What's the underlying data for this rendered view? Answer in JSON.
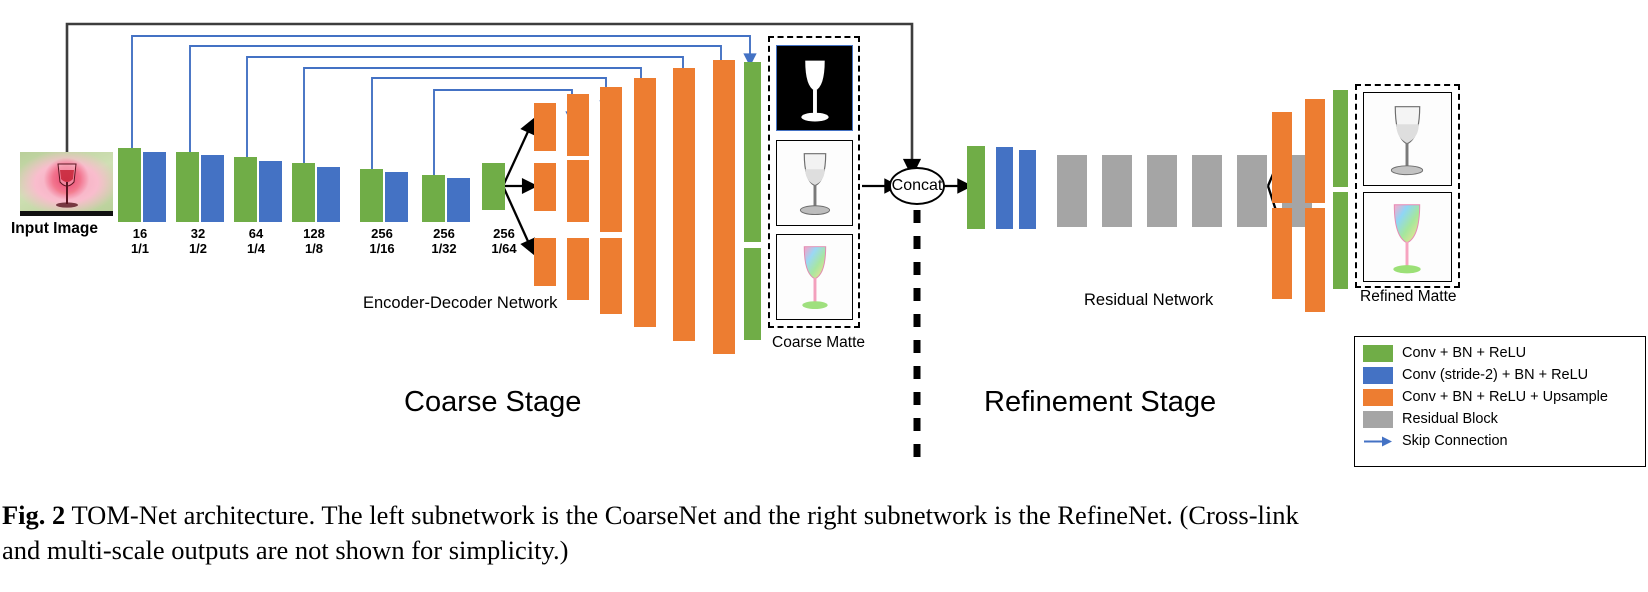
{
  "figure": {
    "caption_prefix": "Fig. 2",
    "caption_line1": "TOM-Net architecture. The left subnetwork is the CoarseNet and the right subnetwork is the RefineNet. (Cross-link",
    "caption_line2": "and multi-scale outputs are not shown for simplicity.)"
  },
  "colors": {
    "conv": "#70AD47",
    "conv_stride2": "#4472C4",
    "conv_upsample": "#ED7D31",
    "residual": "#A5A5A5",
    "skip": "#4472C4",
    "arrow": "#000000"
  },
  "labels": {
    "input_image": "Input Image",
    "encoder_decoder": "Encoder-Decoder Network",
    "coarse_matte": "Coarse Matte",
    "coarse_stage": "Coarse Stage",
    "concat": "Concat",
    "residual_network": "Residual Network",
    "refined_matte": "Refined Matte",
    "refinement_stage": "Refinement Stage"
  },
  "encoder": {
    "stages": [
      {
        "channels": "16",
        "scale": "1/1"
      },
      {
        "channels": "32",
        "scale": "1/2"
      },
      {
        "channels": "64",
        "scale": "1/4"
      },
      {
        "channels": "128",
        "scale": "1/8"
      },
      {
        "channels": "256",
        "scale": "1/16"
      },
      {
        "channels": "256",
        "scale": "1/32"
      },
      {
        "channels": "256",
        "scale": "1/64"
      }
    ]
  },
  "decoder": {
    "branches": 3,
    "blocks_per_branch": 6,
    "output_conv_segments": 3
  },
  "refinement": {
    "residual_blocks": 6,
    "head_conv": 1,
    "head_stride2_convs": 2,
    "tail_upsample_blocks_per_branch": 2,
    "tail_branches": 2
  },
  "legend": {
    "items": [
      {
        "icon": "green-square-icon",
        "swatch": "#70AD47",
        "label": "Conv + BN + ReLU"
      },
      {
        "icon": "blue-square-icon",
        "swatch": "#4472C4",
        "label": "Conv (stride-2) + BN + ReLU"
      },
      {
        "icon": "orange-square-icon",
        "swatch": "#ED7D31",
        "label": "Conv + BN + ReLU + Upsample"
      },
      {
        "icon": "gray-square-icon",
        "swatch": "#A5A5A5",
        "label": "Residual Block"
      },
      {
        "icon": "blue-arrow-icon",
        "swatch": "#4472C4",
        "label": "Skip Connection"
      }
    ]
  }
}
